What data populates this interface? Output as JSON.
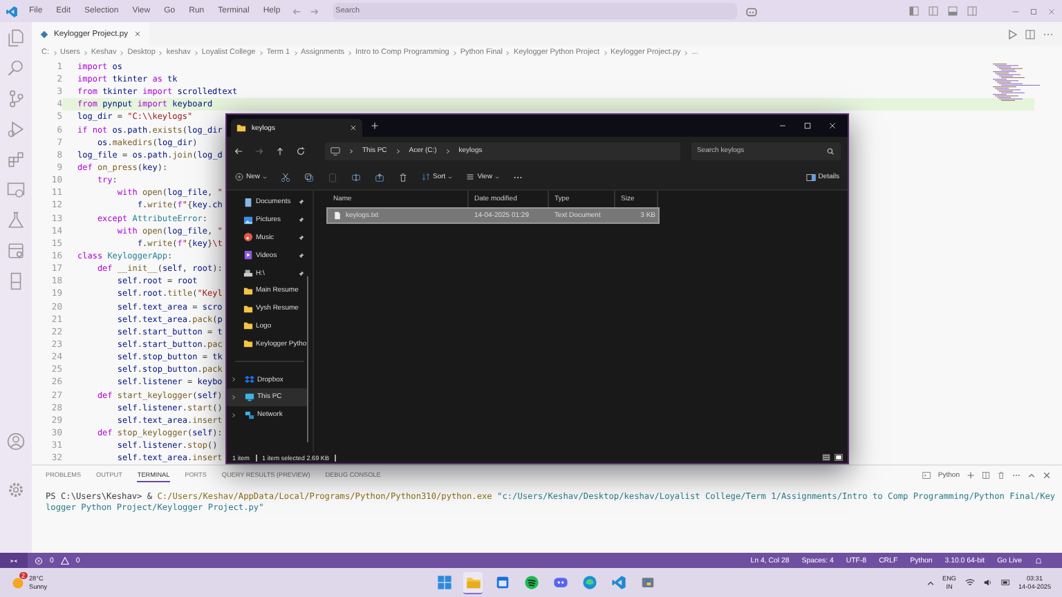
{
  "menu": [
    "File",
    "Edit",
    "Selection",
    "View",
    "Go",
    "Run",
    "Terminal",
    "Help"
  ],
  "search": {
    "placeholder": "Search"
  },
  "editor_tab": {
    "label": "Keylogger Project.py",
    "selected": true
  },
  "breadcrumb": [
    "C:",
    "Users",
    "Keshav",
    "Desktop",
    "keshav",
    "Loyalist College",
    "Term 1",
    "Assignments",
    "Intro to Comp Programming",
    "Python Final",
    "Keylogger Python Project",
    "Keylogger Project.py",
    "..."
  ],
  "code": [
    {
      "n": "1",
      "current": false,
      "tokens": [
        {
          "kind": "kw",
          "text": "import "
        },
        {
          "kind": "v",
          "text": "os"
        }
      ]
    },
    {
      "n": "2",
      "current": false,
      "tokens": [
        {
          "kind": "kw",
          "text": "import "
        },
        {
          "kind": "v",
          "text": "tkinter "
        },
        {
          "kind": "kw",
          "text": "as "
        },
        {
          "kind": "v",
          "text": "tk"
        }
      ]
    },
    {
      "n": "3",
      "current": false,
      "tokens": [
        {
          "kind": "kw",
          "text": "from "
        },
        {
          "kind": "v",
          "text": "tkinter "
        },
        {
          "kind": "kw",
          "text": "import "
        },
        {
          "kind": "v",
          "text": "scrolledtext"
        }
      ]
    },
    {
      "n": "4",
      "current": true,
      "tokens": [
        {
          "kind": "kw",
          "text": "from "
        },
        {
          "kind": "v",
          "text": "pynput "
        },
        {
          "kind": "kw",
          "text": "import "
        },
        {
          "kind": "v",
          "text": "keyboard"
        }
      ]
    },
    {
      "n": "5",
      "current": false,
      "tokens": [
        {
          "kind": "v",
          "text": "log_dir"
        },
        {
          "kind": "p",
          "text": " = "
        },
        {
          "kind": "s",
          "text": "\"C:\\\\keylogs\""
        }
      ]
    },
    {
      "n": "6",
      "current": false,
      "tokens": [
        {
          "kind": "kw",
          "text": "if not "
        },
        {
          "kind": "v",
          "text": "os"
        },
        {
          "kind": "p",
          "text": "."
        },
        {
          "kind": "v",
          "text": "path"
        },
        {
          "kind": "p",
          "text": "."
        },
        {
          "kind": "f",
          "text": "exists"
        },
        {
          "kind": "p",
          "text": "("
        },
        {
          "kind": "v",
          "text": "log_dir"
        }
      ]
    },
    {
      "n": "7",
      "current": false,
      "tokens": [
        {
          "kind": "v",
          "text": "    os"
        },
        {
          "kind": "p",
          "text": "."
        },
        {
          "kind": "f",
          "text": "makedirs"
        },
        {
          "kind": "p",
          "text": "("
        },
        {
          "kind": "v",
          "text": "log_dir"
        },
        {
          "kind": "p",
          "text": ")"
        }
      ]
    },
    {
      "n": "8",
      "current": false,
      "tokens": [
        {
          "kind": "v",
          "text": "log_file"
        },
        {
          "kind": "p",
          "text": " = "
        },
        {
          "kind": "v",
          "text": "os"
        },
        {
          "kind": "p",
          "text": "."
        },
        {
          "kind": "v",
          "text": "path"
        },
        {
          "kind": "p",
          "text": "."
        },
        {
          "kind": "f",
          "text": "join"
        },
        {
          "kind": "p",
          "text": "("
        },
        {
          "kind": "v",
          "text": "log_d"
        }
      ]
    },
    {
      "n": "9",
      "current": false,
      "tokens": [
        {
          "kind": "kw",
          "text": "def "
        },
        {
          "kind": "f",
          "text": "on_press"
        },
        {
          "kind": "p",
          "text": "("
        },
        {
          "kind": "v",
          "text": "key"
        },
        {
          "kind": "p",
          "text": "):"
        }
      ]
    },
    {
      "n": "10",
      "current": false,
      "tokens": [
        {
          "kind": "kw",
          "text": "    try"
        },
        {
          "kind": "p",
          "text": ":"
        }
      ]
    },
    {
      "n": "11",
      "current": false,
      "tokens": [
        {
          "kind": "kw",
          "text": "        with "
        },
        {
          "kind": "f",
          "text": "open"
        },
        {
          "kind": "p",
          "text": "("
        },
        {
          "kind": "v",
          "text": "log_file"
        },
        {
          "kind": "p",
          "text": ", "
        },
        {
          "kind": "s",
          "text": "\""
        }
      ]
    },
    {
      "n": "12",
      "current": false,
      "tokens": [
        {
          "kind": "v",
          "text": "            f"
        },
        {
          "kind": "p",
          "text": "."
        },
        {
          "kind": "f",
          "text": "write"
        },
        {
          "kind": "p",
          "text": "("
        },
        {
          "kind": "kw",
          "text": "f"
        },
        {
          "kind": "s",
          "text": "\""
        },
        {
          "kind": "p",
          "text": "{"
        },
        {
          "kind": "v",
          "text": "key"
        },
        {
          "kind": "p",
          "text": "."
        },
        {
          "kind": "v",
          "text": "ch"
        }
      ]
    },
    {
      "n": "13",
      "current": false,
      "tokens": [
        {
          "kind": "kw",
          "text": "    except "
        },
        {
          "kind": "t",
          "text": "AttributeError"
        },
        {
          "kind": "p",
          "text": ":"
        }
      ]
    },
    {
      "n": "14",
      "current": false,
      "tokens": [
        {
          "kind": "kw",
          "text": "        with "
        },
        {
          "kind": "f",
          "text": "open"
        },
        {
          "kind": "p",
          "text": "("
        },
        {
          "kind": "v",
          "text": "log_file"
        },
        {
          "kind": "p",
          "text": ", "
        },
        {
          "kind": "s",
          "text": "\""
        }
      ]
    },
    {
      "n": "15",
      "current": false,
      "tokens": [
        {
          "kind": "v",
          "text": "            f"
        },
        {
          "kind": "p",
          "text": "."
        },
        {
          "kind": "f",
          "text": "write"
        },
        {
          "kind": "p",
          "text": "("
        },
        {
          "kind": "kw",
          "text": "f"
        },
        {
          "kind": "s",
          "text": "\""
        },
        {
          "kind": "p",
          "text": "{"
        },
        {
          "kind": "v",
          "text": "key"
        },
        {
          "kind": "p",
          "text": "}"
        },
        {
          "kind": "s",
          "text": "\\t"
        }
      ]
    },
    {
      "n": "16",
      "current": false,
      "tokens": [
        {
          "kind": "kw",
          "text": "class "
        },
        {
          "kind": "t",
          "text": "KeyloggerApp"
        },
        {
          "kind": "p",
          "text": ":"
        }
      ]
    },
    {
      "n": "17",
      "current": false,
      "tokens": [
        {
          "kind": "kw",
          "text": "    def "
        },
        {
          "kind": "f",
          "text": "__init__"
        },
        {
          "kind": "p",
          "text": "("
        },
        {
          "kind": "v",
          "text": "self"
        },
        {
          "kind": "p",
          "text": ", "
        },
        {
          "kind": "v",
          "text": "root"
        },
        {
          "kind": "p",
          "text": "):"
        }
      ]
    },
    {
      "n": "18",
      "current": false,
      "tokens": [
        {
          "kind": "v",
          "text": "        self"
        },
        {
          "kind": "p",
          "text": "."
        },
        {
          "kind": "v",
          "text": "root"
        },
        {
          "kind": "p",
          "text": " = "
        },
        {
          "kind": "v",
          "text": "root"
        }
      ]
    },
    {
      "n": "19",
      "current": false,
      "tokens": [
        {
          "kind": "v",
          "text": "        self"
        },
        {
          "kind": "p",
          "text": "."
        },
        {
          "kind": "v",
          "text": "root"
        },
        {
          "kind": "p",
          "text": "."
        },
        {
          "kind": "f",
          "text": "title"
        },
        {
          "kind": "p",
          "text": "("
        },
        {
          "kind": "s",
          "text": "\"Keyl"
        }
      ]
    },
    {
      "n": "20",
      "current": false,
      "tokens": [
        {
          "kind": "v",
          "text": "        self"
        },
        {
          "kind": "p",
          "text": "."
        },
        {
          "kind": "v",
          "text": "text_area"
        },
        {
          "kind": "p",
          "text": " = "
        },
        {
          "kind": "v",
          "text": "scro"
        }
      ]
    },
    {
      "n": "21",
      "current": false,
      "tokens": [
        {
          "kind": "v",
          "text": "        self"
        },
        {
          "kind": "p",
          "text": "."
        },
        {
          "kind": "v",
          "text": "text_area"
        },
        {
          "kind": "p",
          "text": "."
        },
        {
          "kind": "f",
          "text": "pack"
        },
        {
          "kind": "p",
          "text": "("
        },
        {
          "kind": "v",
          "text": "p"
        }
      ]
    },
    {
      "n": "22",
      "current": false,
      "tokens": [
        {
          "kind": "v",
          "text": "        self"
        },
        {
          "kind": "p",
          "text": "."
        },
        {
          "kind": "v",
          "text": "start_button"
        },
        {
          "kind": "p",
          "text": " = "
        },
        {
          "kind": "v",
          "text": "t"
        }
      ]
    },
    {
      "n": "23",
      "current": false,
      "tokens": [
        {
          "kind": "v",
          "text": "        self"
        },
        {
          "kind": "p",
          "text": "."
        },
        {
          "kind": "v",
          "text": "start_button"
        },
        {
          "kind": "p",
          "text": "."
        },
        {
          "kind": "f",
          "text": "pac"
        }
      ]
    },
    {
      "n": "24",
      "current": false,
      "tokens": [
        {
          "kind": "v",
          "text": "        self"
        },
        {
          "kind": "p",
          "text": "."
        },
        {
          "kind": "v",
          "text": "stop_button"
        },
        {
          "kind": "p",
          "text": " = "
        },
        {
          "kind": "v",
          "text": "tk"
        }
      ]
    },
    {
      "n": "25",
      "current": false,
      "tokens": [
        {
          "kind": "v",
          "text": "        self"
        },
        {
          "kind": "p",
          "text": "."
        },
        {
          "kind": "v",
          "text": "stop_button"
        },
        {
          "kind": "p",
          "text": "."
        },
        {
          "kind": "f",
          "text": "pack"
        }
      ]
    },
    {
      "n": "26",
      "current": false,
      "tokens": [
        {
          "kind": "v",
          "text": "        self"
        },
        {
          "kind": "p",
          "text": "."
        },
        {
          "kind": "v",
          "text": "listener"
        },
        {
          "kind": "p",
          "text": " = "
        },
        {
          "kind": "v",
          "text": "keybo"
        }
      ]
    },
    {
      "n": "27",
      "current": false,
      "tokens": [
        {
          "kind": "kw",
          "text": "    def "
        },
        {
          "kind": "f",
          "text": "start_keylogger"
        },
        {
          "kind": "p",
          "text": "("
        },
        {
          "kind": "v",
          "text": "self"
        },
        {
          "kind": "p",
          "text": ")"
        }
      ]
    },
    {
      "n": "28",
      "current": false,
      "tokens": [
        {
          "kind": "v",
          "text": "        self"
        },
        {
          "kind": "p",
          "text": "."
        },
        {
          "kind": "v",
          "text": "listener"
        },
        {
          "kind": "p",
          "text": "."
        },
        {
          "kind": "f",
          "text": "start"
        },
        {
          "kind": "p",
          "text": "()"
        }
      ]
    },
    {
      "n": "29",
      "current": false,
      "tokens": [
        {
          "kind": "v",
          "text": "        self"
        },
        {
          "kind": "p",
          "text": "."
        },
        {
          "kind": "v",
          "text": "text_area"
        },
        {
          "kind": "p",
          "text": "."
        },
        {
          "kind": "f",
          "text": "insert"
        }
      ]
    },
    {
      "n": "30",
      "current": false,
      "tokens": [
        {
          "kind": "kw",
          "text": "    def "
        },
        {
          "kind": "f",
          "text": "stop_keylogger"
        },
        {
          "kind": "p",
          "text": "("
        },
        {
          "kind": "v",
          "text": "self"
        },
        {
          "kind": "p",
          "text": "):"
        }
      ]
    },
    {
      "n": "31",
      "current": false,
      "tokens": [
        {
          "kind": "v",
          "text": "        self"
        },
        {
          "kind": "p",
          "text": "."
        },
        {
          "kind": "v",
          "text": "listener"
        },
        {
          "kind": "p",
          "text": "."
        },
        {
          "kind": "f",
          "text": "stop"
        },
        {
          "kind": "p",
          "text": "()"
        }
      ]
    },
    {
      "n": "32",
      "current": false,
      "tokens": [
        {
          "kind": "v",
          "text": "        self"
        },
        {
          "kind": "p",
          "text": "."
        },
        {
          "kind": "v",
          "text": "text_area"
        },
        {
          "kind": "p",
          "text": "."
        },
        {
          "kind": "f",
          "text": "insert"
        }
      ]
    }
  ],
  "file_explorer": {
    "tab": {
      "label": "keylogs",
      "selected": true
    },
    "address": [
      "This PC",
      "Acer (C:)",
      "keylogs"
    ],
    "search": {
      "placeholder": "Search keylogs"
    },
    "toolbar": {
      "new": "New",
      "sort": "Sort",
      "view": "View",
      "details": "Details"
    },
    "nav": [
      {
        "label": "Documents",
        "kind": "documents",
        "pinned": true,
        "selected": false
      },
      {
        "label": "Pictures",
        "kind": "pictures",
        "pinned": true,
        "selected": false
      },
      {
        "label": "Music",
        "kind": "music",
        "pinned": true,
        "selected": false
      },
      {
        "label": "Videos",
        "kind": "videos",
        "pinned": true,
        "selected": false
      },
      {
        "label": "H:\\",
        "kind": "drive",
        "pinned": true,
        "selected": false
      },
      {
        "label": "Main Resume",
        "kind": "folder",
        "pinned": false,
        "selected": false
      },
      {
        "label": "Vysh Resume",
        "kind": "folder",
        "pinned": false,
        "selected": false
      },
      {
        "label": "Logo",
        "kind": "folder",
        "pinned": false,
        "selected": false
      },
      {
        "label": "Keylogger Pytho",
        "kind": "folder",
        "pinned": false,
        "selected": false
      }
    ],
    "nav_roots": [
      {
        "label": "Dropbox",
        "kind": "cloud",
        "selected": false
      },
      {
        "label": "This PC",
        "kind": "pc",
        "selected": true
      },
      {
        "label": "Network",
        "kind": "network",
        "selected": false
      }
    ],
    "columns": [
      "Name",
      "Date modified",
      "Type",
      "Size"
    ],
    "rows": [
      {
        "name": "keylogs.txt",
        "date": "14-04-2025 01:29",
        "type": "Text Document",
        "size": "3 KB",
        "selected": true
      }
    ],
    "status": {
      "count": "1 item",
      "selection": "1 item selected  2.69 KB"
    }
  },
  "panel": {
    "tabs": [
      {
        "label": "PROBLEMS",
        "selected": false
      },
      {
        "label": "OUTPUT",
        "selected": false
      },
      {
        "label": "TERMINAL",
        "selected": true
      },
      {
        "label": "PORTS",
        "selected": false
      },
      {
        "label": "QUERY RESULTS (PREVIEW)",
        "selected": false
      },
      {
        "label": "DEBUG CONSOLE",
        "selected": false
      }
    ],
    "shell": "Python",
    "terminal": [
      {
        "kind": "p",
        "text": "PS C:\\Users\\Keshav> & "
      },
      {
        "kind": "f",
        "text": "C:/Users/Keshav/AppData/Local/Programs/Python/Python310/python.exe "
      },
      {
        "kind": "s",
        "text": "\"c:/Users/Keshav/Desktop/keshav/Loyalist College/Term 1/Assignments/Intro to Comp Programming/Python Final/Keylogger Python Project/Keylogger Project.py\""
      }
    ]
  },
  "status_bar": {
    "errors": "0",
    "warnings": "0",
    "right": [
      "Ln 4, Col 28",
      "Spaces: 4",
      "UTF-8",
      "CRLF",
      "Python",
      "3.10.0 64-bit",
      "Go Live"
    ]
  },
  "taskbar": {
    "weather": {
      "temp": "28°C",
      "desc": "Sunny",
      "badge": "2"
    },
    "apps": [
      {
        "kind": "start",
        "selected": false
      },
      {
        "kind": "files",
        "selected": true
      },
      {
        "kind": "calendar",
        "selected": false
      },
      {
        "kind": "music",
        "selected": false
      },
      {
        "kind": "chat",
        "selected": false
      },
      {
        "kind": "browser",
        "selected": false
      },
      {
        "kind": "code",
        "selected": false
      },
      {
        "kind": "python",
        "selected": false
      }
    ],
    "lang": [
      "ENG",
      "IN"
    ],
    "time": "03:31",
    "date": "14-04-2025"
  }
}
